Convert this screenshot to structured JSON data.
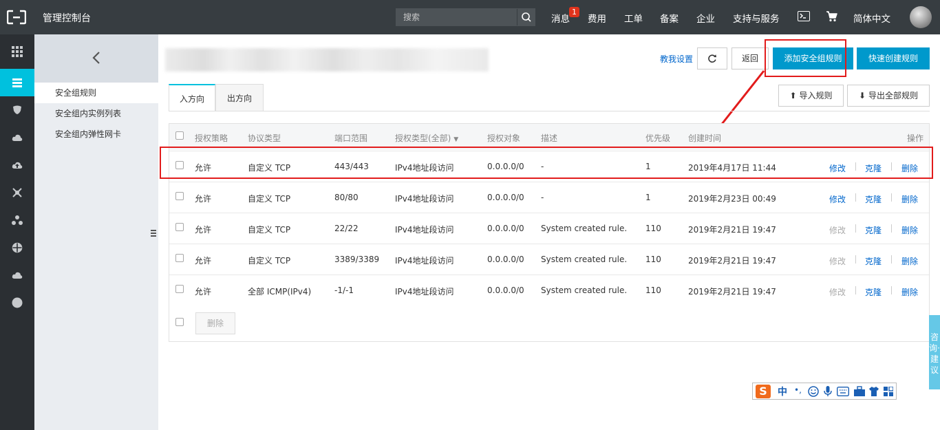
{
  "topbar": {
    "console_title": "管理控制台",
    "search_placeholder": "搜索",
    "nav": {
      "messages": "消息",
      "messages_badge": "1",
      "billing": "费用",
      "tickets": "工单",
      "icp": "备案",
      "enterprise": "企业",
      "support": "支持与服务",
      "language": "简体中文"
    }
  },
  "sidebar": {
    "items": [
      {
        "label": "安全组规则",
        "active": true
      },
      {
        "label": "安全组内实例列表",
        "active": false
      },
      {
        "label": "安全组内弹性网卡",
        "active": false
      }
    ]
  },
  "header": {
    "help_link": "教我设置",
    "back_label": "返回",
    "add_rule_label": "添加安全组规则",
    "quick_create_label": "快速创建规则",
    "import_label": "导入规则",
    "export_label": "导出全部规则"
  },
  "tabs": [
    {
      "label": "入方向",
      "active": true
    },
    {
      "label": "出方向",
      "active": false
    }
  ],
  "table": {
    "columns": [
      "授权策略",
      "协议类型",
      "端口范围",
      "授权类型(全部)",
      "授权对象",
      "描述",
      "优先级",
      "创建时间",
      "操作"
    ],
    "rows": [
      {
        "policy": "允许",
        "protocol": "自定义 TCP",
        "port": "443/443",
        "auth_type": "IPv4地址段访问",
        "object": "0.0.0.0/0",
        "desc": "-",
        "priority": "1",
        "created": "2019年4月17日 11:44",
        "edit": "修改",
        "edit_disabled": false,
        "clone": "克隆",
        "delete": "删除"
      },
      {
        "policy": "允许",
        "protocol": "自定义 TCP",
        "port": "80/80",
        "auth_type": "IPv4地址段访问",
        "object": "0.0.0.0/0",
        "desc": "-",
        "priority": "1",
        "created": "2019年2月23日 00:49",
        "edit": "修改",
        "edit_disabled": false,
        "clone": "克隆",
        "delete": "删除"
      },
      {
        "policy": "允许",
        "protocol": "自定义 TCP",
        "port": "22/22",
        "auth_type": "IPv4地址段访问",
        "object": "0.0.0.0/0",
        "desc": "System created rule.",
        "priority": "110",
        "created": "2019年2月21日 19:47",
        "edit": "修改",
        "edit_disabled": true,
        "clone": "克隆",
        "delete": "删除"
      },
      {
        "policy": "允许",
        "protocol": "自定义 TCP",
        "port": "3389/3389",
        "auth_type": "IPv4地址段访问",
        "object": "0.0.0.0/0",
        "desc": "System created rule.",
        "priority": "110",
        "created": "2019年2月21日 19:47",
        "edit": "修改",
        "edit_disabled": true,
        "clone": "克隆",
        "delete": "删除"
      },
      {
        "policy": "允许",
        "protocol": "全部 ICMP(IPv4)",
        "port": "-1/-1",
        "auth_type": "IPv4地址段访问",
        "object": "0.0.0.0/0",
        "desc": "System created rule.",
        "priority": "110",
        "created": "2019年2月21日 19:47",
        "edit": "修改",
        "edit_disabled": true,
        "clone": "克隆",
        "delete": "删除"
      }
    ],
    "bulk_delete_label": "删除"
  },
  "consult_tab": "咨询·建议",
  "ime": {
    "logo": "S",
    "mode": "中",
    "punct": "•,"
  },
  "colors": {
    "topbar": "#373d41",
    "rail": "#2b2f33",
    "accent": "#00c1de",
    "primary": "#0099cc",
    "link": "#0066cc",
    "annotation": "#e21b1b"
  }
}
